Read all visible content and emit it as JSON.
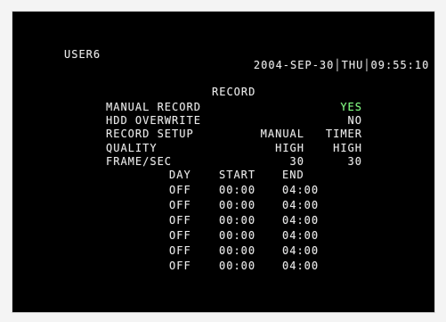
{
  "header": {
    "user": "USER6",
    "date": "2004-SEP-30",
    "day": "THU",
    "time": "09:55:10"
  },
  "menu": {
    "title": "RECORD",
    "manual_record": {
      "label": "MANUAL RECORD",
      "value": "YES"
    },
    "hdd_overwrite": {
      "label": "HDD OVERWRITE",
      "value": "NO"
    },
    "record_setup": {
      "label": "RECORD SETUP",
      "col1": "MANUAL",
      "col2": "TIMER"
    },
    "quality": {
      "label": "QUALITY",
      "col1": "HIGH",
      "col2": "HIGH"
    },
    "frame_sec": {
      "label": "FRAME/SEC",
      "col1": "30",
      "col2": "30"
    }
  },
  "schedule": {
    "headers": {
      "day": "DAY",
      "start": "START",
      "end": "END"
    },
    "rows": [
      {
        "day": "OFF",
        "start": "00:00",
        "end": "04:00"
      },
      {
        "day": "OFF",
        "start": "00:00",
        "end": "04:00"
      },
      {
        "day": "OFF",
        "start": "00:00",
        "end": "04:00"
      },
      {
        "day": "OFF",
        "start": "00:00",
        "end": "04:00"
      },
      {
        "day": "OFF",
        "start": "00:00",
        "end": "04:00"
      },
      {
        "day": "OFF",
        "start": "00:00",
        "end": "04:00"
      }
    ]
  },
  "colors": {
    "accent": "#7cff7c"
  }
}
